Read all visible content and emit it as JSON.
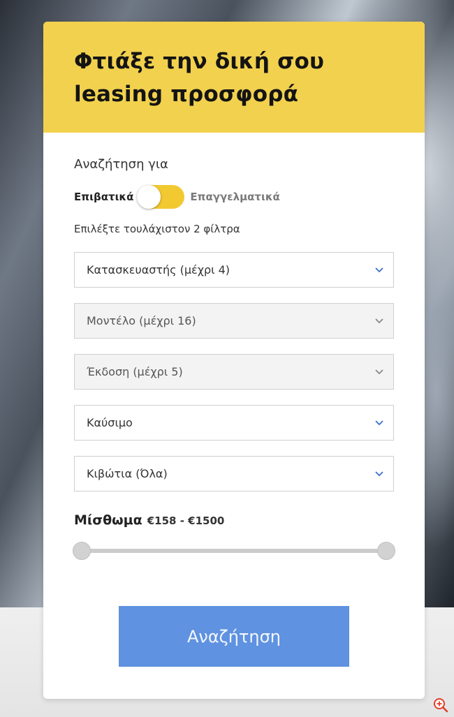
{
  "header": {
    "title_line1": "Φτιάξε την δική σου",
    "title_line2": "leasing προσφορά"
  },
  "search_for_label": "Αναζήτηση για",
  "vehicle_type_toggle": {
    "left_label": "Επιβατικά",
    "right_label": "Επαγγελματικά",
    "selected": "Επαγγελματικά"
  },
  "filters_hint": "Επιλέξτε τουλάχιστον 2 φίλτρα",
  "filters": [
    {
      "label": "Κατασκευαστής (μέχρι 4)",
      "enabled": true
    },
    {
      "label": "Μοντέλο (μέχρι 16)",
      "enabled": false
    },
    {
      "label": "Έκδοση (μέχρι 5)",
      "enabled": false
    },
    {
      "label": "Καύσιμο",
      "enabled": true
    },
    {
      "label": "Κιβώτια (Όλα)",
      "enabled": true
    }
  ],
  "rent": {
    "label": "Μίσθωμα",
    "range_text": "€158 - €1500",
    "min": 158,
    "max": 1500,
    "selected_min": 158,
    "selected_max": 1500
  },
  "search_button_label": "Αναζήτηση",
  "colors": {
    "header_yellow": "#f2d14e",
    "toggle_yellow": "#f2c930",
    "button_blue": "#5f92e0",
    "chevron_enabled": "#3b6fc9",
    "chevron_disabled": "#888888"
  },
  "icons": {
    "select_arrow": "chevron-down-icon",
    "zoom": "zoom-in-icon"
  }
}
